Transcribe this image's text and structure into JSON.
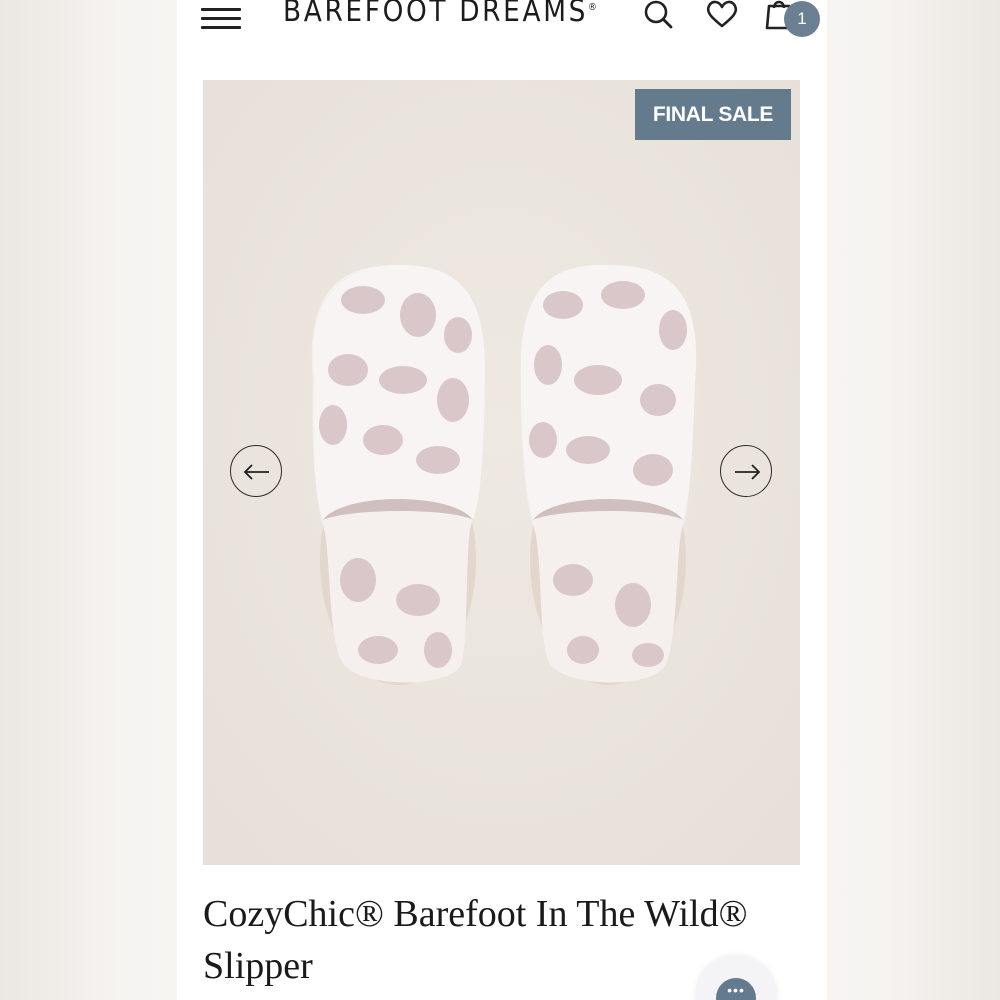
{
  "header": {
    "brand": "BAREFOOT DREAMS",
    "brand_mark": "®",
    "cart_count": "1",
    "icons": [
      "menu-icon",
      "search-icon",
      "heart-icon",
      "shopping-bag-icon"
    ]
  },
  "gallery": {
    "badge": "FINAL SALE",
    "prev_icon": "arrow-left-icon",
    "next_icon": "arrow-right-icon"
  },
  "product": {
    "title": "CozyChic® Barefoot In The Wild® Slipper"
  },
  "chat": {
    "icon": "chat-icon",
    "dots": "•••"
  },
  "colors": {
    "accent": "#637b8d",
    "photo_background": "#ebe6df",
    "slipper_base": "#f6f1ee",
    "leopard_spots": "#d8c6c8"
  }
}
